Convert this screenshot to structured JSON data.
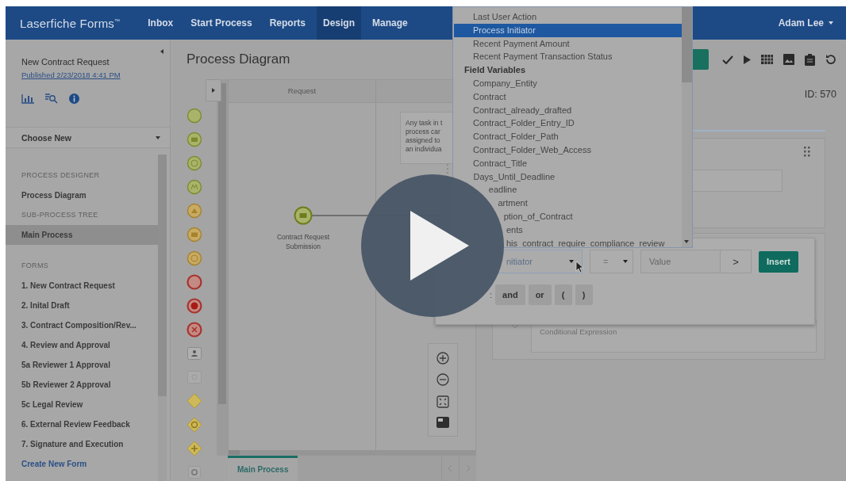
{
  "nav": {
    "logo": "Laserfiche Forms",
    "trademark": "™",
    "items": [
      {
        "label": "Inbox",
        "selected": false
      },
      {
        "label": "Start Process",
        "selected": false
      },
      {
        "label": "Reports",
        "selected": false
      },
      {
        "label": "Design",
        "selected": true
      },
      {
        "label": "Manage",
        "selected": false
      }
    ],
    "user": "Adam Lee"
  },
  "sidebar": {
    "process_name": "New Contract Request",
    "published": "Published 2/23/2018 4:41 PM",
    "choose_new": "Choose New",
    "items": [
      {
        "kind": "header",
        "label": "PROCESS DESIGNER"
      },
      {
        "kind": "item",
        "label": "Process Diagram",
        "selected": false
      },
      {
        "kind": "header",
        "label": "SUB-PROCESS TREE"
      },
      {
        "kind": "item",
        "label": "Main Process",
        "selected": true
      },
      {
        "kind": "gap"
      },
      {
        "kind": "header",
        "label": "FORMS"
      },
      {
        "kind": "item",
        "label": "1. New Contract Request",
        "selected": false
      },
      {
        "kind": "item",
        "label": "2. Inital Draft",
        "selected": false
      },
      {
        "kind": "item",
        "label": "3. Contract Composition/Rev...",
        "selected": false
      },
      {
        "kind": "item",
        "label": "4. Review and Approval",
        "selected": false
      },
      {
        "kind": "item",
        "label": "5a Reviewer 1 Approval",
        "selected": false
      },
      {
        "kind": "item",
        "label": "5b Reviewer 2 Approval",
        "selected": false
      },
      {
        "kind": "item",
        "label": "5c Legal Review",
        "selected": false
      },
      {
        "kind": "item",
        "label": "6. External Review Feedback",
        "selected": false
      },
      {
        "kind": "item",
        "label": "7. Signature and Execution",
        "selected": false
      },
      {
        "kind": "link",
        "label": "Create New Form",
        "selected": false
      }
    ]
  },
  "page_title": "Process Diagram",
  "diagram": {
    "lanes": [
      "Request"
    ],
    "note": [
      "Any task in t",
      "process car",
      "assigned to",
      "an individua"
    ],
    "start_event": {
      "label": "Contract Request Submission"
    },
    "tabs": [
      {
        "label": "Main Process",
        "selected": true
      }
    ]
  },
  "properties": {
    "id": "ID: 570",
    "expression_placeholder": "Conditional Expression"
  },
  "condition_editor": {
    "field": "nitiator",
    "operator": "=",
    "value_placeholder": "Value",
    "next": ">",
    "insert": "Insert",
    "operator_label": ":",
    "operator_buttons": [
      "and",
      "or",
      "(",
      ")"
    ]
  },
  "dropdown": {
    "items": [
      {
        "kind": "option",
        "label": "Last User Action",
        "selected": false
      },
      {
        "kind": "option",
        "label": "Process Initiator",
        "selected": true
      },
      {
        "kind": "option",
        "label": "Recent Payment Amount",
        "selected": false
      },
      {
        "kind": "option",
        "label": "Recent Payment Transaction Status",
        "selected": false
      },
      {
        "kind": "group",
        "label": "Field Variables"
      },
      {
        "kind": "option",
        "label": "Company_Entity",
        "selected": false
      },
      {
        "kind": "option",
        "label": "Contract",
        "selected": false
      },
      {
        "kind": "option",
        "label": "Contract_already_drafted",
        "selected": false
      },
      {
        "kind": "option",
        "label": "Contract_Folder_Entry_ID",
        "selected": false
      },
      {
        "kind": "option",
        "label": "Contract_Folder_Path",
        "selected": false
      },
      {
        "kind": "option",
        "label": "Contract_Folder_Web_Access",
        "selected": false
      },
      {
        "kind": "option",
        "label": "Contract_Title",
        "selected": false
      },
      {
        "kind": "option",
        "label": "Days_Until_Deadline",
        "selected": false
      },
      {
        "kind": "option",
        "label": "eadline",
        "selected": false
      },
      {
        "kind": "option",
        "label": "artment",
        "selected": false
      },
      {
        "kind": "option",
        "label": "ption_of_Contract",
        "selected": false
      },
      {
        "kind": "option",
        "label": "ents",
        "selected": false
      },
      {
        "kind": "option",
        "label": "his_contract_require_compliance_review_",
        "selected": false
      }
    ]
  }
}
